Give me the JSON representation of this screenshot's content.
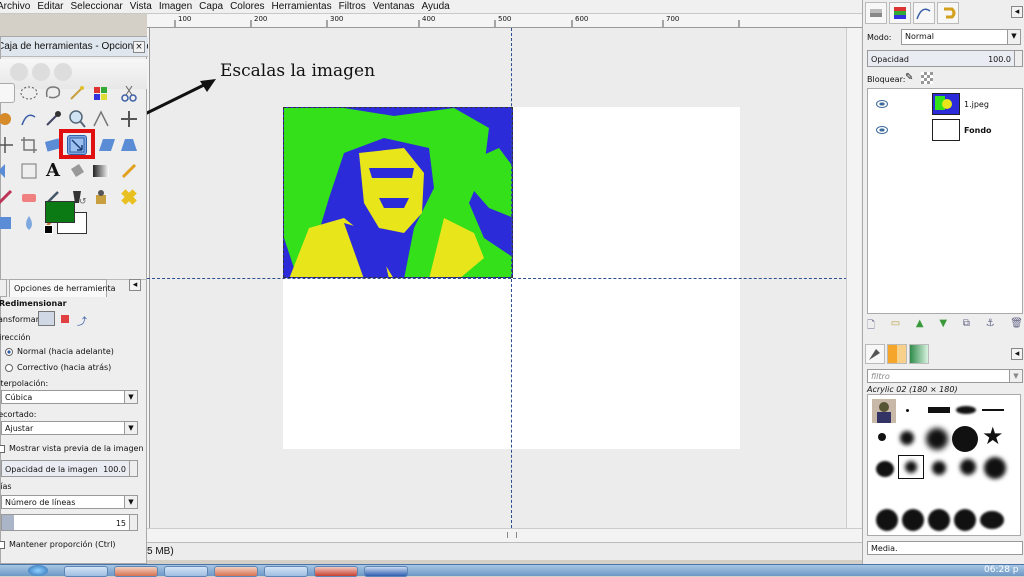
{
  "menubar": {
    "items": [
      "Archivo",
      "Editar",
      "Seleccionar",
      "Vista",
      "Imagen",
      "Capa",
      "Colores",
      "Herramientas",
      "Filtros",
      "Ventanas",
      "Ayuda"
    ]
  },
  "annotation": {
    "text": "Escalas la imagen",
    "highlight_color": "#e01010"
  },
  "ruler": {
    "ticks": [
      "100",
      "200",
      "300",
      "400",
      "500",
      "600",
      "700"
    ]
  },
  "canvas": {
    "status_text": "5 MB)",
    "photo_colors": {
      "blue": "#2b2bd9",
      "green": "#33e01a",
      "yellow": "#e8e61a"
    }
  },
  "toolbox": {
    "title": "Caja de herramientas - Opciones de herramienta",
    "fg_color": "#0b7a14",
    "bg_color": "#ffffff",
    "options_tab": "Opciones de herramienta",
    "options": {
      "section": "Redimensionar",
      "transform_label": "Transformar:",
      "direction_label": "Dirección",
      "radio_normal": "Normal (hacia adelante)",
      "radio_corrective": "Correctivo (hacia atrás)",
      "interpolation_label": "Interpolación:",
      "interpolation_value": "Cúbica",
      "clipping_label": "Recortado:",
      "clipping_value": "Ajustar",
      "preview_label": "Mostrar vista previa de la imagen",
      "opacity_label": "Opacidad de la imagen",
      "opacity_value": "100.0",
      "guides_label": "Guías",
      "guides_value": "Número de líneas",
      "lines_value": "15",
      "keep_ratio_label": "Mantener proporción  (Ctrl)"
    }
  },
  "dock": {
    "mode_label": "Modo:",
    "mode_value": "Normal",
    "opacity_label": "Opacidad",
    "opacity_value": "100.0",
    "lock_label": "Bloquear:",
    "layers": [
      {
        "name": "1.jpeg"
      },
      {
        "name": "Fondo"
      }
    ],
    "filter_placeholder": "filtro",
    "brush_name": "Acrylic 02 (180 × 180)",
    "bottom_label": "Media."
  },
  "taskbar": {
    "clock": "06:28 p"
  }
}
